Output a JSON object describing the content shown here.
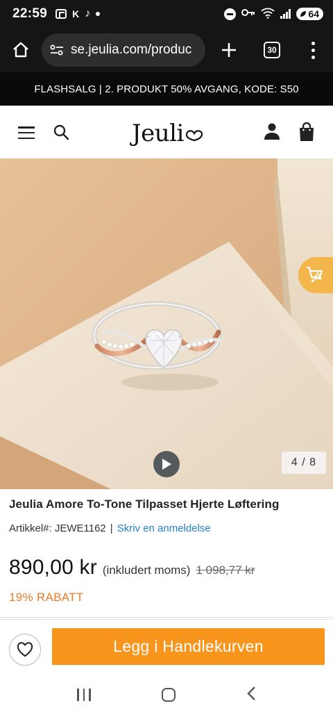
{
  "status_bar": {
    "time": "22:59",
    "k_label": "K",
    "battery": "64"
  },
  "browser": {
    "url": "se.jeulia.com/produc",
    "tab_count": "30"
  },
  "promo": {
    "text": "FLASHSALG | 2. PRODUKT 50% AVGANG, KODE: S50"
  },
  "header": {
    "logo": "Jeuli"
  },
  "gallery": {
    "counter": "4 / 8"
  },
  "product": {
    "title": "Jeulia Amore To-Tone Tilpasset Hjerte Løftering",
    "sku_label": "Artikkel#: JEWE1162",
    "separator": "|",
    "review_link": "Skriv en anmeldelse",
    "price": "890,00 kr",
    "price_note": "(inkludert moms)",
    "old_price": "1 098,77 kr",
    "discount": "19% RABATT"
  },
  "actions": {
    "add_to_cart": "Legg i Handlekurven"
  },
  "colors": {
    "accent": "#f7951d",
    "discount": "#e8792a",
    "link": "#2283c9",
    "cart_float": "#f3b64a"
  }
}
